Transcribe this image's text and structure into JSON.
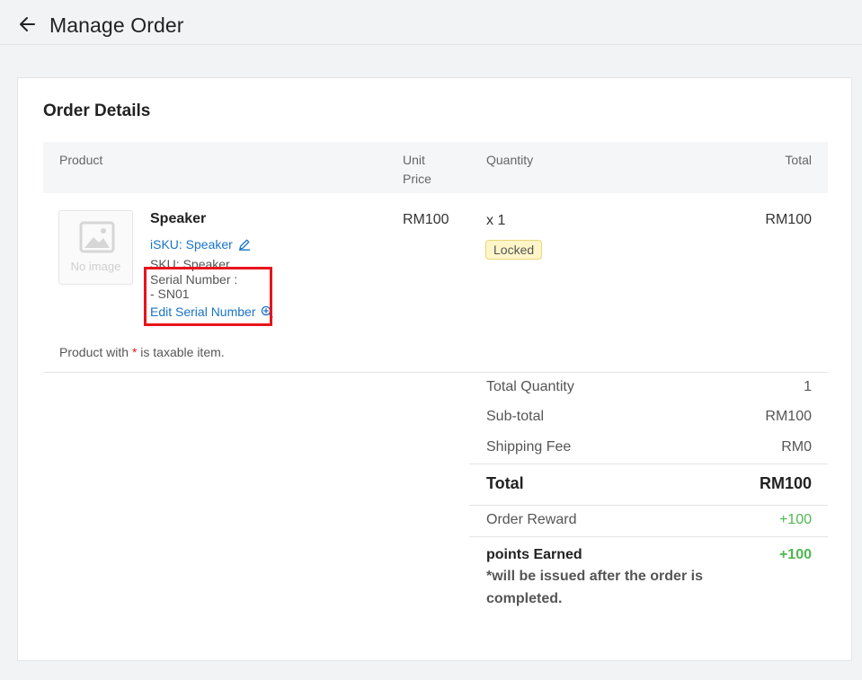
{
  "header": {
    "title": "Manage Order",
    "back_icon": "arrow-left-icon"
  },
  "order_details": {
    "title": "Order Details",
    "columns": {
      "product": "Product",
      "unit_price": "Unit Price",
      "quantity": "Quantity",
      "total": "Total"
    },
    "item": {
      "image_placeholder": "No image",
      "name": "Speaker",
      "isku": "iSKU: Speaker",
      "sku": "SKU: Speaker",
      "serial_number_label": "Serial Number :",
      "serial_number_value": "- SN01",
      "edit_serial_number": "Edit Serial Number",
      "unit_price": "RM100",
      "quantity": "x 1",
      "status": "Locked",
      "total": "RM100"
    },
    "tax_note_prefix": "Product with ",
    "tax_note_star": "*",
    "tax_note_suffix": " is taxable item."
  },
  "summary": {
    "total_quantity_label": "Total Quantity",
    "total_quantity_value": "1",
    "subtotal_label": "Sub-total",
    "subtotal_value": "RM100",
    "shipping_label": "Shipping Fee",
    "shipping_value": "RM0",
    "total_label": "Total",
    "total_value": "RM100",
    "reward_label": "Order Reward",
    "reward_value": "+100",
    "points_label": "points Earned",
    "points_value": "+100",
    "points_note": "*will be issued after the order is completed."
  },
  "colors": {
    "link": "#1a73c8",
    "highlight": "#e8141c",
    "positive": "#4fb84f",
    "badge_bg": "#fff5c8"
  }
}
